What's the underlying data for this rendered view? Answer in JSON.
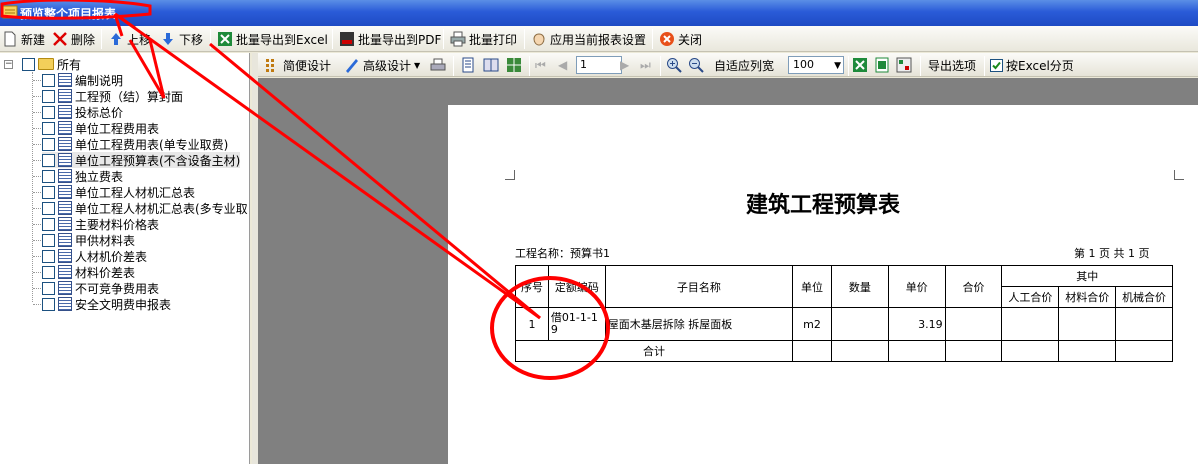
{
  "window": {
    "title": "预览整个项目报表"
  },
  "toolbar": {
    "new": "新建",
    "delete": "删除",
    "move_up": "上移",
    "move_down": "下移",
    "export_excel": "批量导出到Excel",
    "export_pdf": "批量导出到PDF",
    "batch_print": "批量打印",
    "apply_settings": "应用当前报表设置",
    "close": "关闭"
  },
  "tree": {
    "root": "所有",
    "items": [
      "编制说明",
      "工程预（结）算封面",
      "投标总价",
      "单位工程费用表",
      "单位工程费用表(单专业取费)",
      "单位工程预算表(不含设备主材)",
      "独立费表",
      "单位工程人材机汇总表",
      "单位工程人材机汇总表(多专业取",
      "主要材料价格表",
      "甲供材料表",
      "人材机价差表",
      "材料价差表",
      "不可竞争费用表",
      "安全文明费申报表"
    ],
    "selected_index": 5
  },
  "preview_toolbar": {
    "simple_design": "简便设计",
    "advanced_design": "高级设计",
    "page_value": "1",
    "fit_width": "自适应列宽",
    "zoom_value": "100",
    "export_options": "导出选项",
    "excel_paging": "按Excel分页",
    "excel_paging_checked": true
  },
  "report": {
    "title": "建筑工程预算表",
    "project_label": "工程名称：预算书1",
    "page_info": "第 1 页  共 1 页",
    "headers": {
      "seq": "序号",
      "code": "定额编码",
      "name": "子目名称",
      "unit": "单位",
      "qty": "数量",
      "price": "单价",
      "total": "合价",
      "among": "其中",
      "labor": "人工合价",
      "material": "材料合价",
      "machine": "机械合价"
    },
    "rows": [
      {
        "seq": "1",
        "code": "借01-1-19",
        "name": "屋面木基层拆除 拆屋面板",
        "unit": "m2",
        "qty": "",
        "price": "3.19",
        "total": "",
        "labor": "",
        "material": "",
        "machine": ""
      }
    ],
    "sum_label": "合计"
  },
  "colors": {
    "titlebar": "#2a5bd8",
    "annotation": "#ff0000",
    "preview_bg": "#808080"
  }
}
